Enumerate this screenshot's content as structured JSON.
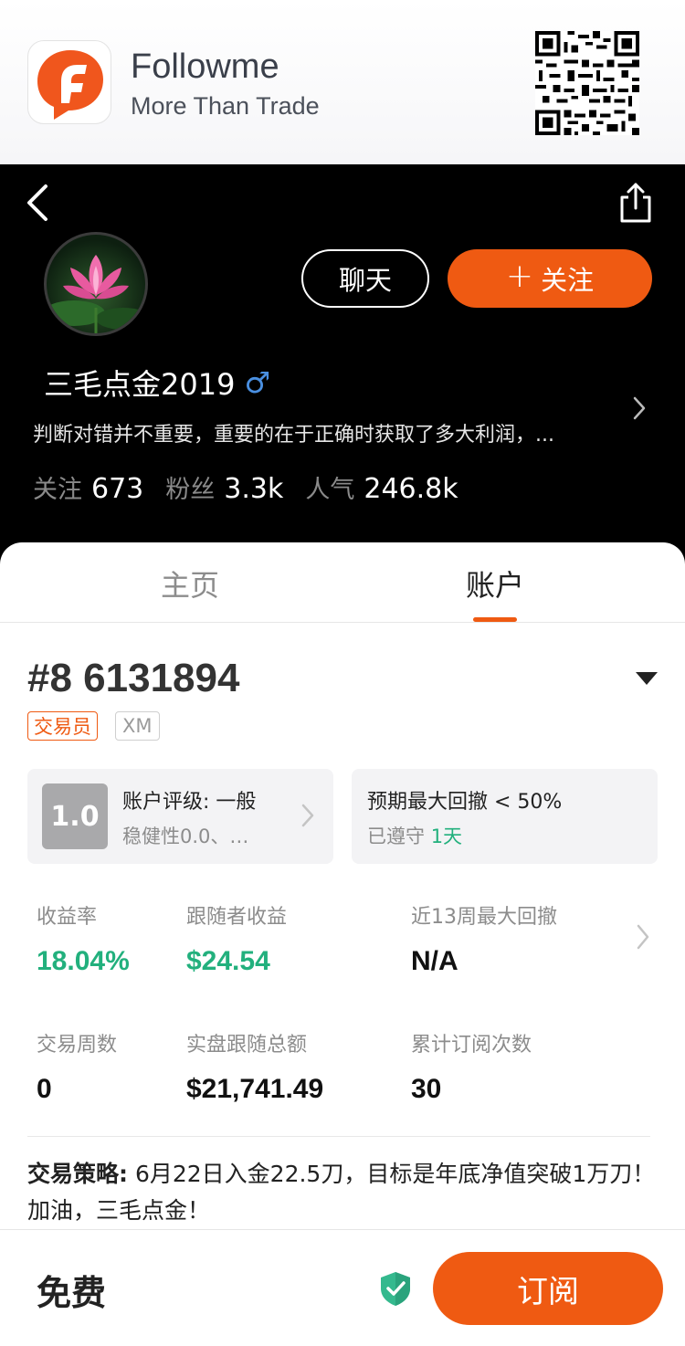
{
  "banner": {
    "app_name": "Followme",
    "slogan": "More Than Trade",
    "logo_icon": "followme-logo-icon",
    "qr_icon": "qr-code-icon"
  },
  "profile": {
    "chat_label": "聊天",
    "follow_plus": "+",
    "follow_label": "关注",
    "username": "三毛点金2019",
    "gender_symbol": "♂",
    "bio": "判断对错并不重要，重要的在于正确时获取了多大利润，...",
    "stats": [
      {
        "label": "关注",
        "value": "673"
      },
      {
        "label": "粉丝",
        "value": "3.3k"
      },
      {
        "label": "人气",
        "value": "246.8k"
      }
    ]
  },
  "tabs": [
    {
      "label": "主页",
      "active": false
    },
    {
      "label": "账户",
      "active": true
    }
  ],
  "account": {
    "number": "#8 6131894",
    "tag_role": "交易员",
    "tag_broker": "XM",
    "rating": {
      "score": "1.0",
      "title": "账户评级: 一般",
      "sub": "稳健性0.0、…"
    },
    "drawdown": {
      "title": "预期最大回撤 < 50%",
      "sub_prefix": "已遵守",
      "days": "1天"
    },
    "metrics": [
      {
        "label": "收益率",
        "value": "18.04%"
      },
      {
        "label": "跟随者收益",
        "value": "$24.54"
      },
      {
        "label": "近13周最大回撤",
        "value": "N/A"
      },
      {
        "label": "交易周数",
        "value": "0"
      },
      {
        "label": "实盘跟随总额",
        "value": "$21,741.49"
      },
      {
        "label": "累计订阅次数",
        "value": "30"
      }
    ],
    "strategy_label": "交易策略:",
    "strategy_text": " 6月22日入金22.5刀，目标是年底净值突破1万刀！加油，三毛点金！"
  },
  "bottom": {
    "price": "免费",
    "subscribe_label": "订阅"
  },
  "colors": {
    "accent": "#ef5a12",
    "positive": "#22b07d",
    "gender": "#4a90e2"
  }
}
